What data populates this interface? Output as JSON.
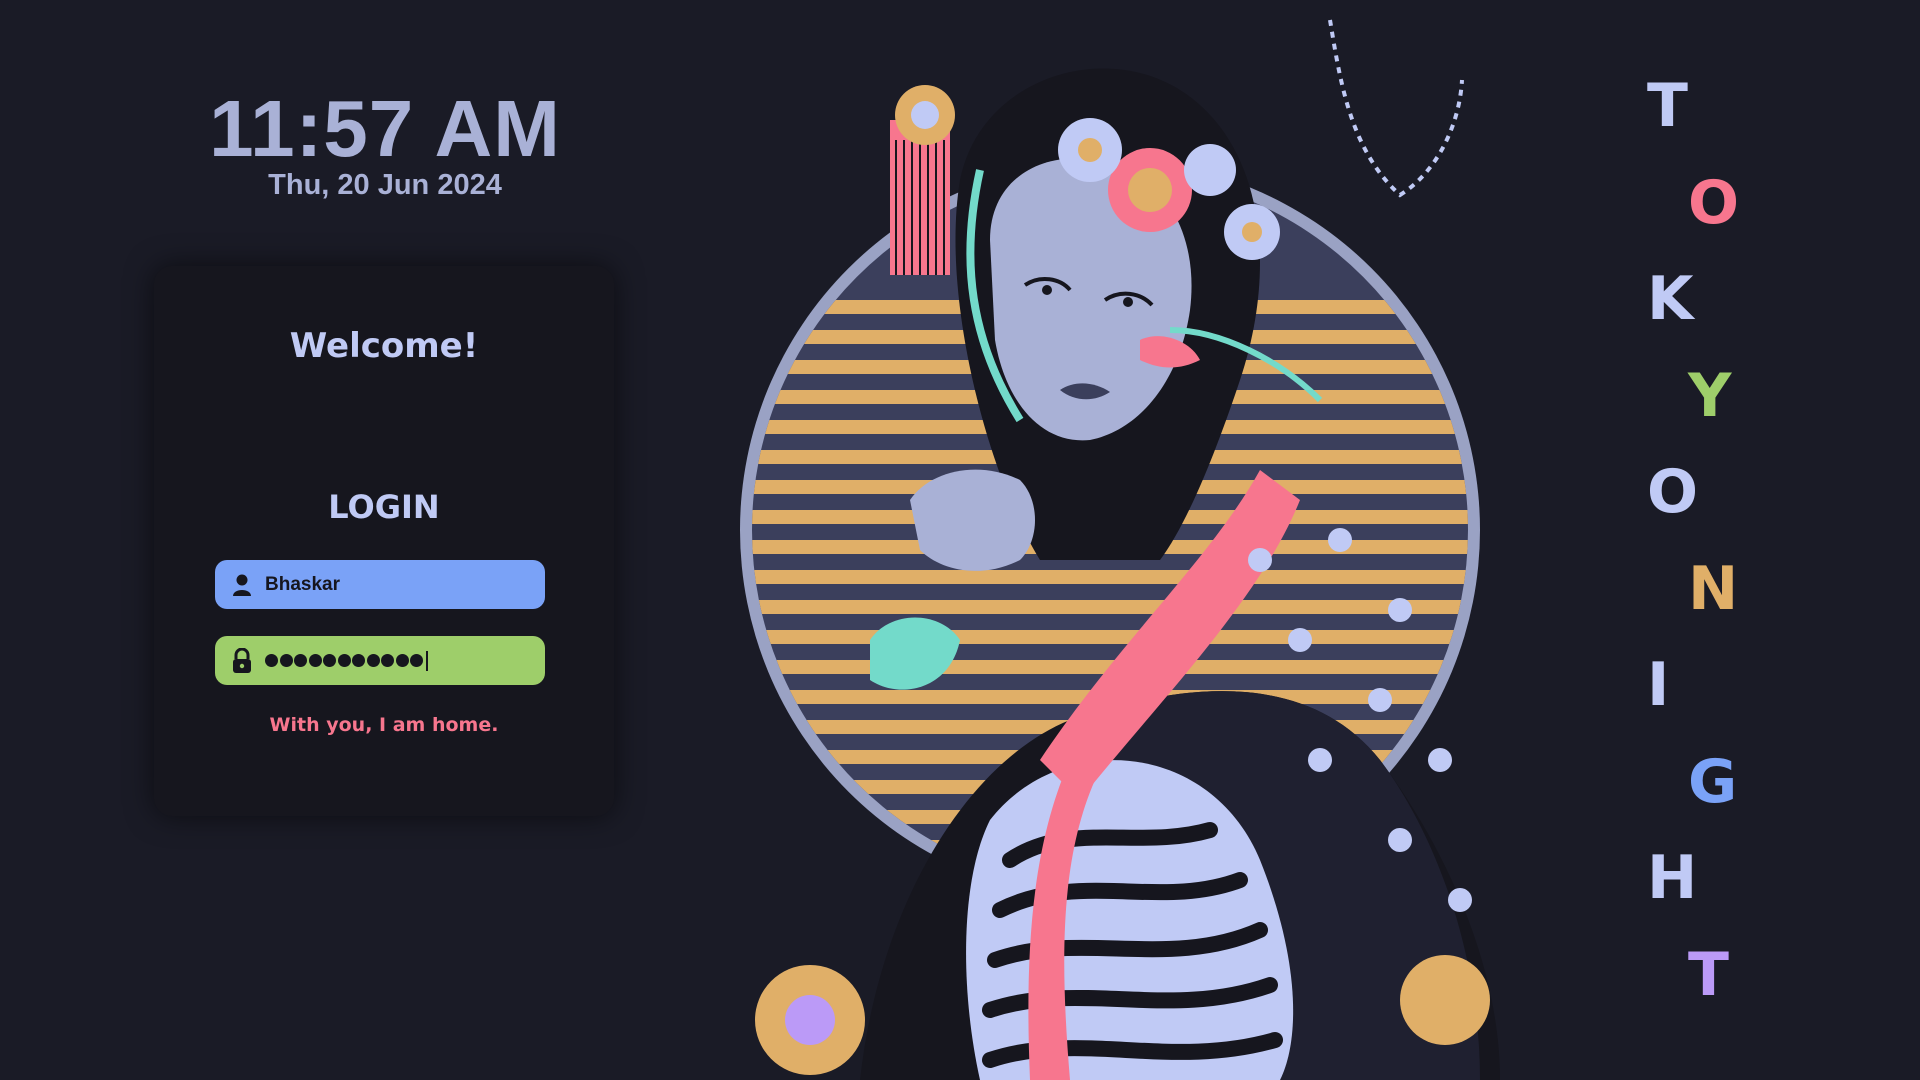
{
  "clock": {
    "time": "11:57 AM",
    "date": "Thu, 20 Jun 2024"
  },
  "login": {
    "welcome": "Welcome!",
    "heading": "LOGIN",
    "username": "Bhaskar",
    "password_mask_count": 11,
    "tagline": "With you, I am home."
  },
  "icons": {
    "user": "user-icon",
    "lock": "lock-icon"
  },
  "title": {
    "letters": [
      {
        "char": "T",
        "color": "#c0caf5"
      },
      {
        "char": "O",
        "color": "#f7768e"
      },
      {
        "char": "K",
        "color": "#c0caf5"
      },
      {
        "char": "Y",
        "color": "#9ece6a"
      },
      {
        "char": "O",
        "color": "#c0caf5"
      },
      {
        "char": "N",
        "color": "#e0af68"
      },
      {
        "char": "I",
        "color": "#c0caf5"
      },
      {
        "char": "G",
        "color": "#7aa2f7"
      },
      {
        "char": "H",
        "color": "#c0caf5"
      },
      {
        "char": "T",
        "color": "#bb9af7"
      }
    ]
  },
  "colors": {
    "background": "#1a1b26",
    "card": "#16161e",
    "text": "#a9b1d6",
    "blue": "#7aa2f7",
    "green": "#9ece6a",
    "red": "#f7768e",
    "yellow": "#e0af68",
    "purple": "#bb9af7"
  }
}
